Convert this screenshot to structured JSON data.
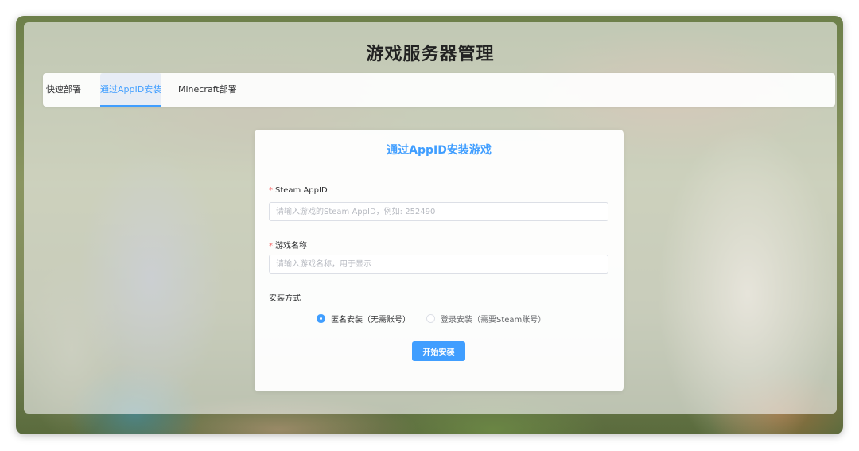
{
  "app": {
    "title": "游戏服务器管理"
  },
  "tabs": [
    {
      "label": "快速部署",
      "active": false
    },
    {
      "label": "通过AppID安装",
      "active": true
    },
    {
      "label": "Minecraft部署",
      "active": false
    }
  ],
  "form": {
    "title": "通过AppID安装游戏",
    "required_mark": "*",
    "appid": {
      "label": "Steam AppID",
      "placeholder": "请输入游戏的Steam AppID，例如: 252490",
      "value": ""
    },
    "name": {
      "label": "游戏名称",
      "placeholder": "请输入游戏名称，用于显示",
      "value": ""
    },
    "install_mode": {
      "label": "安装方式",
      "options": [
        {
          "label": "匿名安装（无需账号）",
          "selected": true
        },
        {
          "label": "登录安装（需要Steam账号）",
          "selected": false
        }
      ]
    },
    "submit_label": "开始安装"
  },
  "colors": {
    "accent": "#409eff",
    "required": "#f56c6c"
  }
}
